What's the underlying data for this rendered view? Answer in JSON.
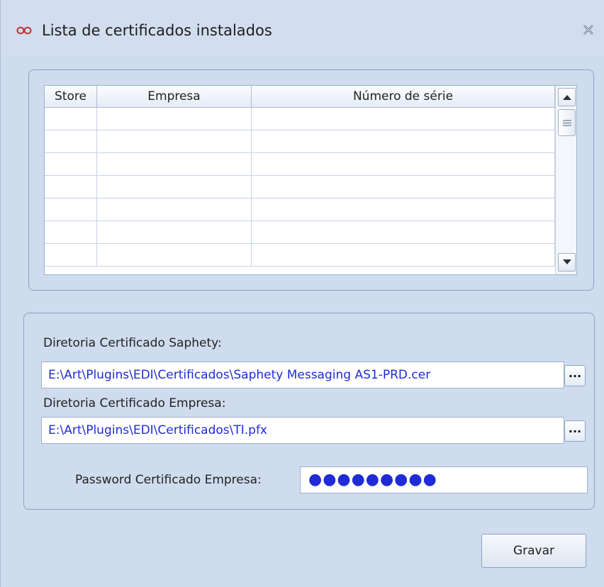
{
  "window": {
    "title": "Lista de certificados instalados",
    "accent_color": "#c03030",
    "icons": {
      "app": "infinity-icon",
      "close": "close-icon"
    }
  },
  "grid": {
    "columns": [
      "Store",
      "Empresa",
      "Número de série"
    ],
    "rows": [
      [
        "",
        "",
        ""
      ],
      [
        "",
        "",
        ""
      ],
      [
        "",
        "",
        ""
      ],
      [
        "",
        "",
        ""
      ],
      [
        "",
        "",
        ""
      ],
      [
        "",
        "",
        ""
      ],
      [
        "",
        "",
        ""
      ]
    ],
    "scroll_icons": {
      "up": "arrow-up-icon",
      "down": "arrow-down-icon",
      "thumb": "grip-icon"
    }
  },
  "form": {
    "saphety_label": "Diretoria Certificado Saphety:",
    "saphety_path": "E:\\Art\\Plugins\\EDI\\Certificados\\Saphety Messaging AS1-PRD.cer",
    "empresa_label": "Diretoria Certificado Empresa:",
    "empresa_path": "E:\\Art\\Plugins\\EDI\\Certificados\\TI.pfx",
    "browse_label": "...",
    "password_label": "Password Certificado Empresa:",
    "password_value": "●●●●●●●●●"
  },
  "actions": {
    "save_label": "Gravar"
  }
}
